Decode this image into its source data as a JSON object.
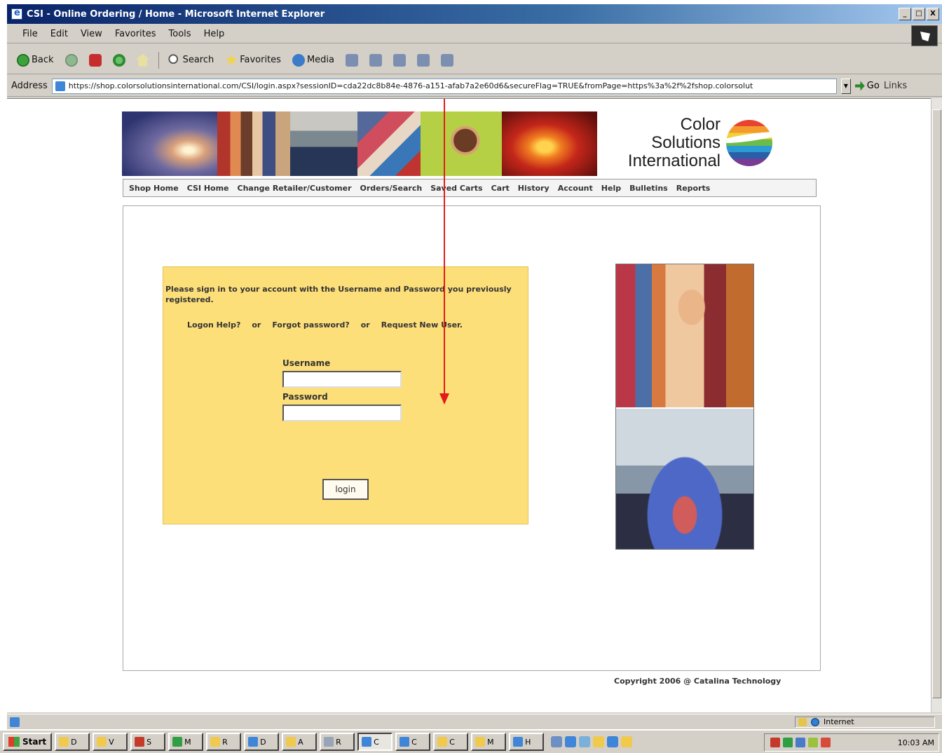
{
  "window": {
    "title": "CSI - Online Ordering / Home - Microsoft Internet Explorer",
    "controls": [
      "_",
      "□",
      "X"
    ]
  },
  "menubar": {
    "items": [
      "File",
      "Edit",
      "View",
      "Favorites",
      "Tools",
      "Help"
    ]
  },
  "toolbar": {
    "back_label": "Back",
    "search_label": "Search",
    "favorites_label": "Favorites",
    "media_label": "Media"
  },
  "addressbar": {
    "label": "Address",
    "url": "https://shop.colorsolutionsinternational.com/CSI/login.aspx?sessionID=cda22dc8b84e-4876-a151-afab7a2e60d6&secureFlag=TRUE&fromPage=https%3a%2f%2fshop.colorsolut",
    "go_label": "Go",
    "links_label": "Links"
  },
  "brand": {
    "logo_text": "Color\nSolutions\nInternational"
  },
  "sitenav": {
    "items": [
      "Shop Home",
      "CSI Home",
      "Change Retailer/Customer",
      "Orders/Search",
      "Saved Carts",
      "Cart",
      "History",
      "Account",
      "Help",
      "Bulletins",
      "Reports"
    ]
  },
  "login": {
    "message": "Please sign in to your account with the Username and Password you previously registered.",
    "links": {
      "logon_help": "Logon Help?",
      "or_1": "or",
      "forgot_password": "Forgot password?",
      "or_2": "or",
      "request_new_user": "Request New User."
    },
    "username_label": "Username",
    "username_value": "",
    "password_label": "Password",
    "password_value": "",
    "login_button": "login"
  },
  "footer": {
    "copyright": "Copyright 2006 @ Catalina Technology"
  },
  "statusbar": {
    "zone_label": "Internet"
  },
  "taskbar": {
    "start_label": "Start",
    "task_buttons": [
      "D",
      "V",
      "S",
      "M",
      "R",
      "D",
      "A",
      "R",
      "C",
      "C",
      "C",
      "M",
      "H"
    ],
    "active_index": 8,
    "clock": "10:03 AM"
  },
  "colors": {
    "login_panel_bg": "#fddf7a",
    "annotation_arrow": "#e41b1b",
    "title_bar": "#0a246a"
  }
}
